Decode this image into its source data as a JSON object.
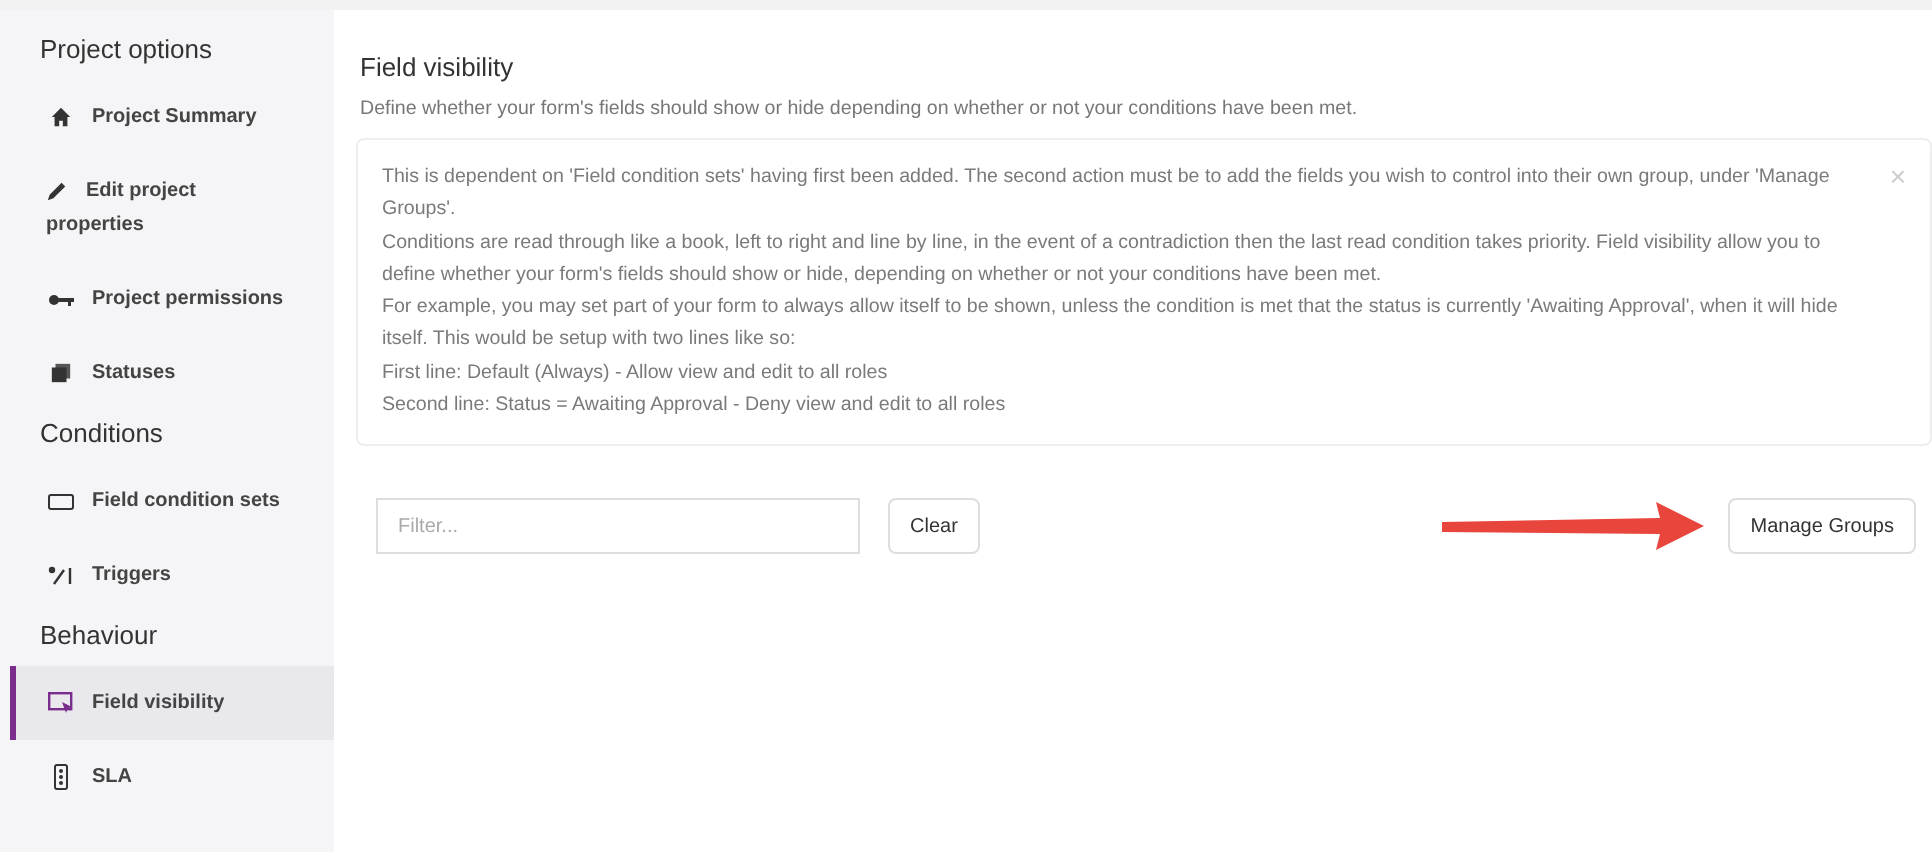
{
  "sidebar": {
    "sections": [
      {
        "title": "Project options",
        "items": [
          {
            "label": "Project Summary",
            "selected": false
          },
          {
            "label": "Edit project properties",
            "selected": false
          },
          {
            "label": "Project permissions",
            "selected": false
          },
          {
            "label": "Statuses",
            "selected": false
          }
        ]
      },
      {
        "title": "Conditions",
        "items": [
          {
            "label": "Field condition sets",
            "selected": false
          },
          {
            "label": "Triggers",
            "selected": false
          }
        ]
      },
      {
        "title": "Behaviour",
        "items": [
          {
            "label": "Field visibility",
            "selected": true
          },
          {
            "label": "SLA",
            "selected": false
          }
        ]
      }
    ]
  },
  "main": {
    "title": "Field visibility",
    "description": "Define whether your form's fields should show or hide depending on whether or not your conditions have been met.",
    "info": {
      "close": "×",
      "lines": [
        "This is dependent on 'Field condition sets' having first been added. The second action must be to add the fields you wish to control into their own group, under 'Manage Groups'.",
        "Conditions are read through like a book, left to right and line by line, in the event of a contradiction then the last read condition takes priority. Field visibility allow you to define whether your form's fields should show or hide, depending on whether or not your conditions have been met.",
        "For example, you may set part of your form to always allow itself to be shown, unless the condition is met that the status is currently 'Awaiting Approval', when it will hide itself. This would be setup with two lines like so:",
        "First line: Default (Always) - Allow view and edit to all roles",
        "Second line: Status = Awaiting Approval - Deny view and edit to all roles"
      ]
    },
    "filter": {
      "placeholder": "Filter..."
    },
    "clear_button": "Clear",
    "manage_button": "Manage Groups"
  }
}
